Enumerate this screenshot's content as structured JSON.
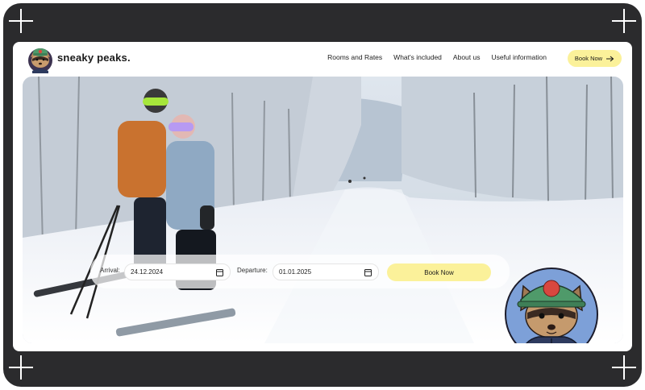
{
  "brand": {
    "name": "sneaky peaks."
  },
  "nav": {
    "links": [
      "Rooms and Rates",
      "What's included",
      "About us",
      "Useful information"
    ],
    "book_label": "Book Now"
  },
  "booking": {
    "arrival_label": "Arrival:",
    "arrival_value": "24.12.2024",
    "departure_label": "Departure:",
    "departure_value": "01.01.2025",
    "book_label": "Book Now"
  },
  "colors": {
    "frame": "#2b2b2d",
    "accent": "#fbf19a"
  }
}
